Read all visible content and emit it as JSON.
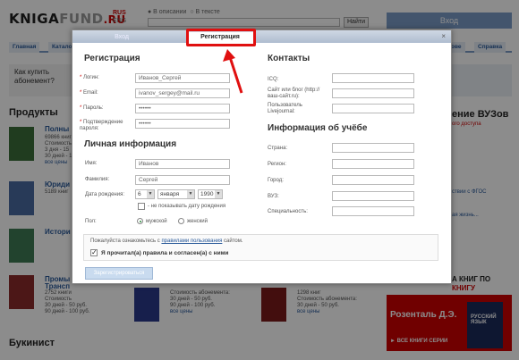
{
  "header": {
    "logo_k": "KNIGA",
    "logo_f": "FUND",
    "logo_r": ".RU",
    "lang_rus": "RUS",
    "lang_eng": "ENG",
    "radio_desc": "● В описании",
    "radio_text": "○ В тексте",
    "search_button": "Найти",
    "login": "Вход"
  },
  "nav": {
    "home": "Главная",
    "catalog": "Катало",
    "other": "ове",
    "help": "Справка"
  },
  "left": {
    "promo": "Как купить абонемент?",
    "products": "Продукты",
    "bukinist": "Букинист",
    "items": [
      {
        "title": "Полны",
        "l1": "69866 книг",
        "l2": "Стоимость",
        "l3": "3 дня - 15",
        "l4": "30 дней - 1",
        "l5": "все цены"
      },
      {
        "title": "Юриди",
        "l1": "5189 книг",
        "l2": "Стоимость",
        "l3": "30 дней -",
        "l4": "90 дней -",
        "l5": ""
      },
      {
        "title": "Истори",
        "l1": "3194 книг",
        "l2": "Стоимость",
        "l3": "30 дней -",
        "l4": "90 дней -",
        "l5": ""
      },
      {
        "title": "Промы",
        "l1": "Трансп",
        "l2": "2752 книги",
        "l3": "Стоимость",
        "l4": "30 дней - 50 руб.",
        "l5": "90 дней - 100 руб."
      }
    ],
    "mid_cols": [
      {
        "l1": "Стоимость абонемента:",
        "l2": "30 дней - 50 руб.",
        "l3": "90 дней - 100 руб.",
        "l4": "все цены"
      },
      {
        "l1": "Стоимость абонемента:",
        "l2": "30 дней - 50 руб.",
        "l3": "90 дней - 100 руб.",
        "l4": "все цены"
      },
      {
        "l1": "1298 книг",
        "l2": "Стоимость абонемента:",
        "l3": "30 дней - 50 руб.",
        "l4": "90 дней - 100 руб.",
        "l5": "все цены"
      }
    ]
  },
  "right": {
    "vuzov": "ение ВУЗов",
    "access": "ого доступа",
    "fgos": "ствии с ФГОС",
    "news": "ая жизнь...",
    "kniga": "А КНИГ ПО",
    "knigu": "КНИГУ",
    "author": "Розенталь Д.Э.",
    "series": "► ВСЕ КНИГИ СЕРИИ",
    "book_title": "РУССКИЙ ЯЗЫК"
  },
  "dialog": {
    "tab_login": "Вход",
    "tab_register": "Регистрация",
    "close": "×",
    "reg_title": "Регистрация",
    "login_label": "Логин:",
    "login_value": "Иванов_Сергей",
    "email_label": "Email:",
    "email_value": "ivanov_sergey@mail.ru",
    "password_label": "Пароль:",
    "password_value": "••••••",
    "confirm_label": "Подтверждение пароля:",
    "confirm_value": "••••••",
    "personal_title": "Личная информация",
    "name_label": "Имя:",
    "name_value": "Иванов",
    "surname_label": "Фамилия:",
    "surname_value": "Сергей",
    "birth_label": "Дата рождения:",
    "birth_day": "6",
    "birth_month": "января",
    "birth_year": "1990",
    "hide_birth": "- не показывать дату рождения",
    "gender_label": "Пол:",
    "male": "мужской",
    "female": "женский",
    "contacts_title": "Контакты",
    "icq_label": "ICQ:",
    "site_label": "Сайт или блог (http://ваш-сайт.ru):",
    "lj_label": "Пользователь Livejournal:",
    "edu_title": "Информация об учёбе",
    "country_label": "Страна:",
    "region_label": "Регион:",
    "city_label": "Город:",
    "vuz_label": "ВУЗ:",
    "spec_label": "Специальность:",
    "agree_pre": "Пожалуйста ознакомьтесь с ",
    "agree_link": "правилами пользования",
    "agree_post": " сайтом.",
    "agree_check": "Я прочитал(а) правила и согласен(а) с ними",
    "submit": "Зарегистрироваться"
  },
  "colors": {
    "accent": "#7b9bc6",
    "highlight": "#e01010"
  }
}
